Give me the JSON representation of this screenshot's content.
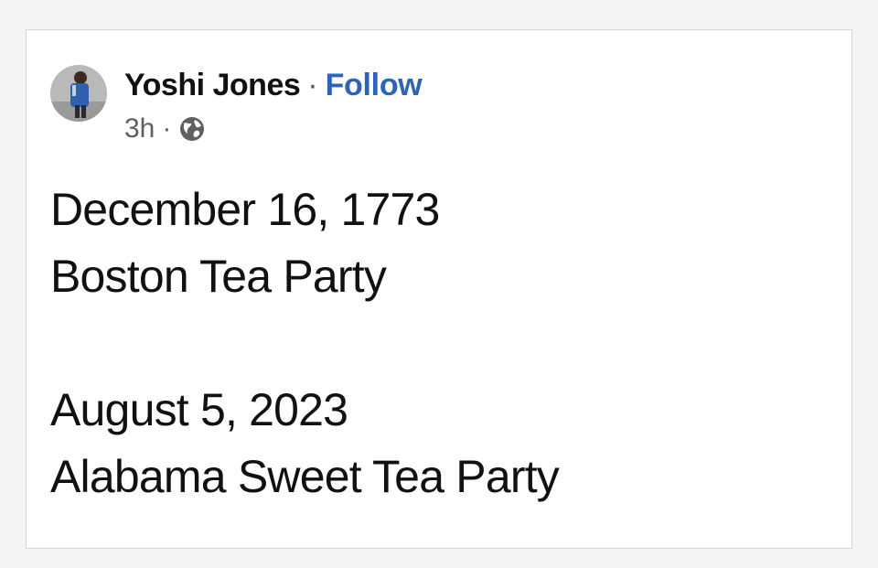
{
  "post": {
    "author": "Yoshi Jones",
    "separator": "·",
    "follow_label": "Follow",
    "timestamp": "3h",
    "meta_separator": "·",
    "privacy_icon": "globe-icon",
    "avatar_icon": "avatar-photo",
    "body": {
      "line1": "December 16, 1773",
      "line2": "Boston Tea Party",
      "line3": "August 5, 2023",
      "line4": "Alabama Sweet Tea Party"
    }
  },
  "colors": {
    "follow_link": "#2c64b8",
    "text": "#111111",
    "meta": "#606060",
    "card_border": "#d6d6d6"
  }
}
